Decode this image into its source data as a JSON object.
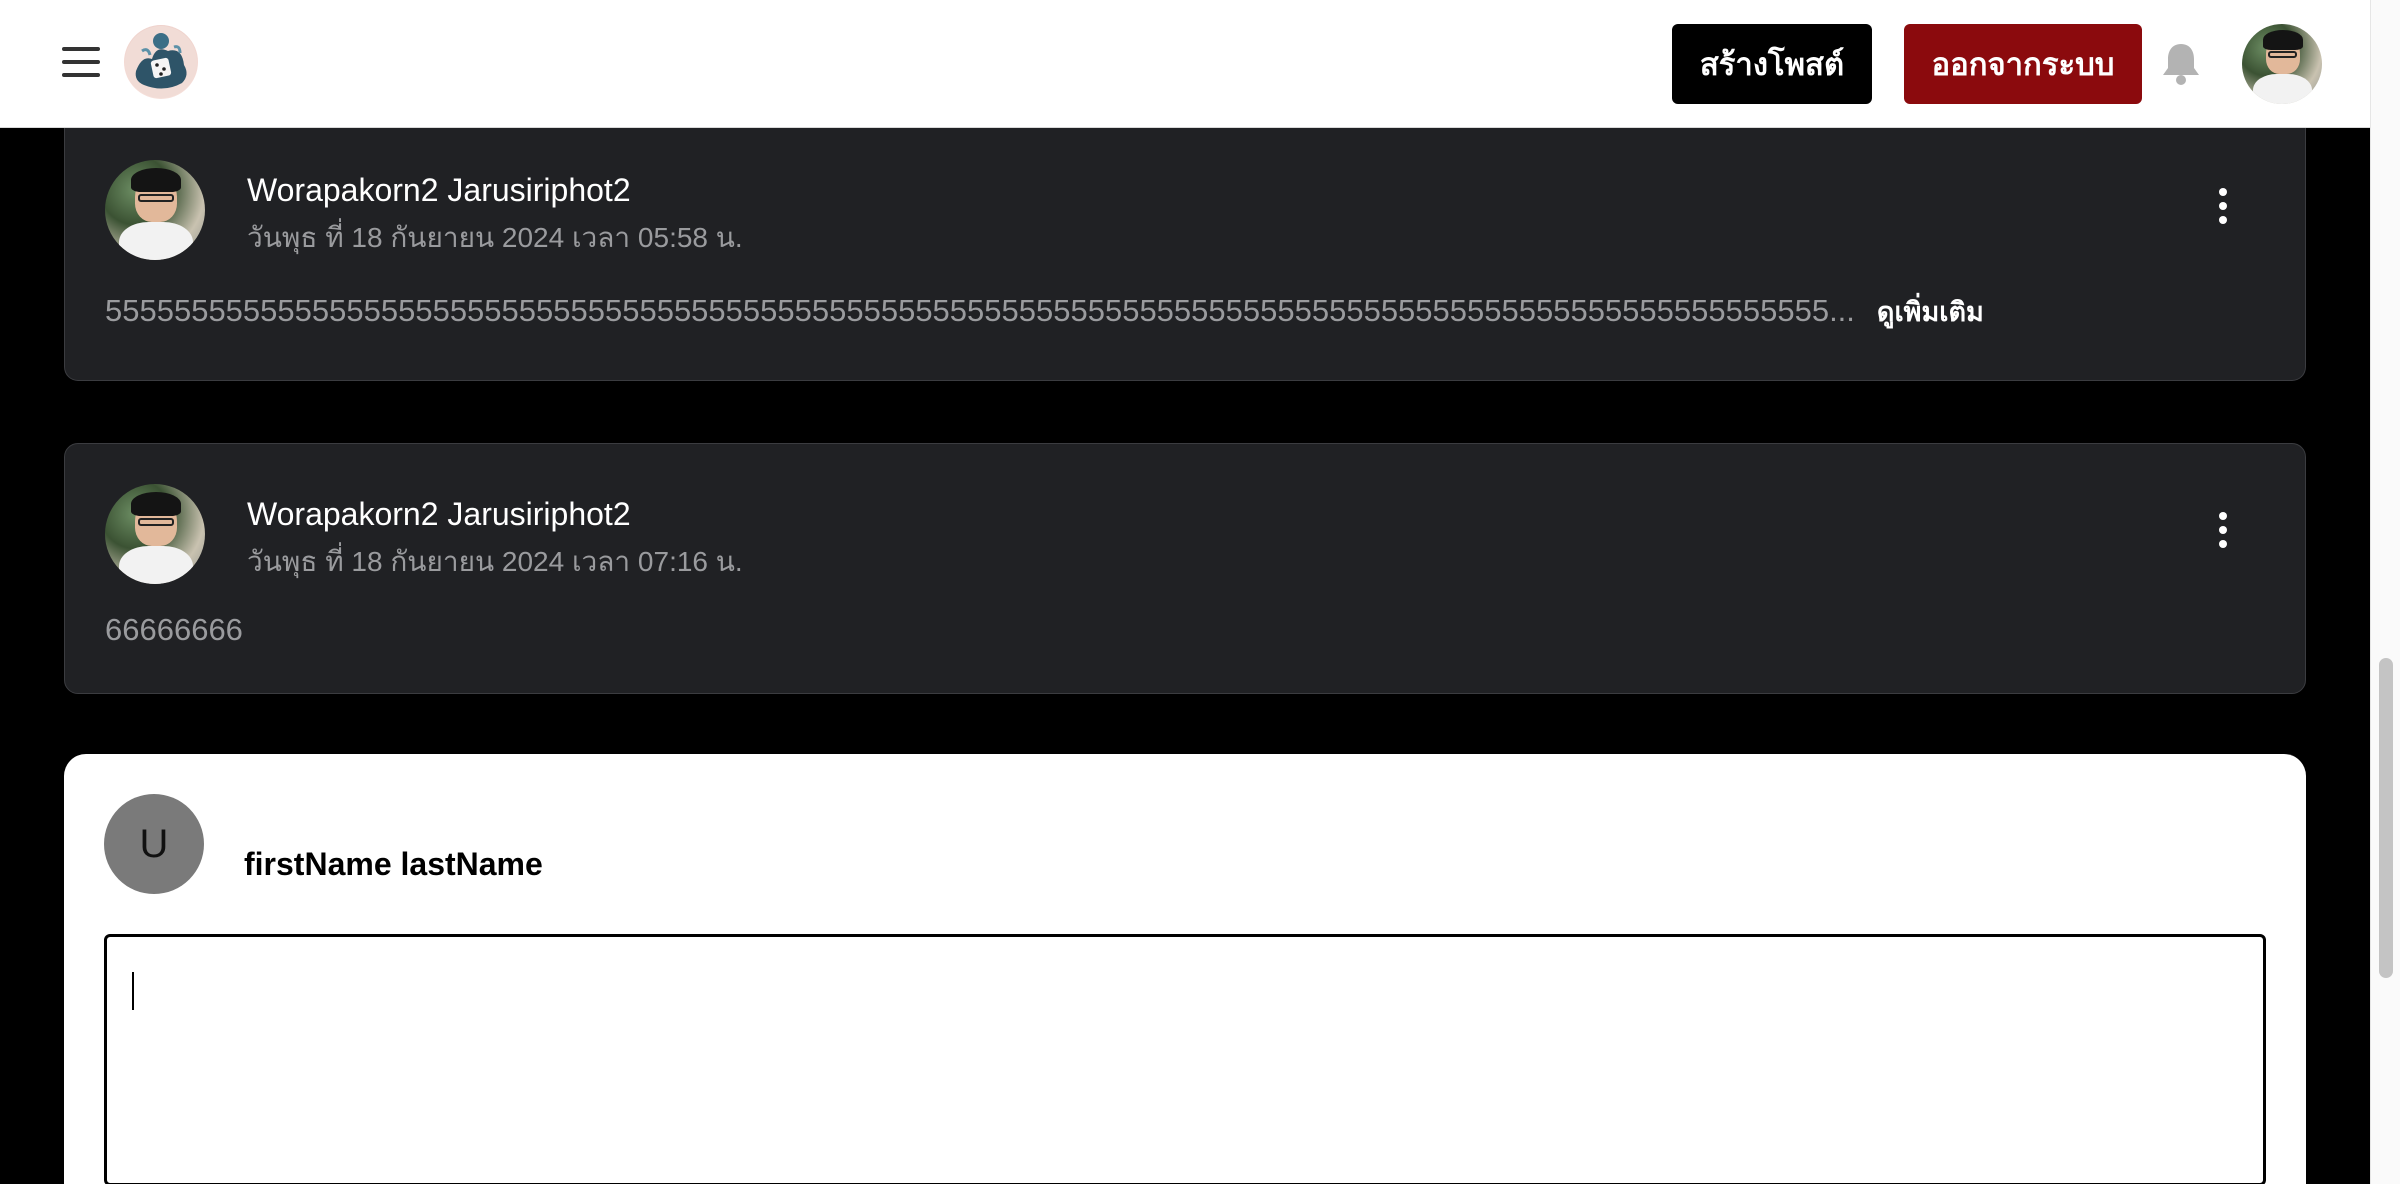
{
  "header": {
    "create_post_label": "สร้างโพสต์",
    "logout_label": "ออกจากระบบ",
    "menu_icon": "menu-icon",
    "logo_icon": "dice-logo-icon",
    "bell_icon": "bell-icon",
    "colors": {
      "create_bg": "#000000",
      "logout_bg": "#8b0a0d"
    }
  },
  "posts": [
    {
      "author": "Worapakorn2 Jarusiriphot2",
      "date": "วันพุธ ที่ 18 กันยายน 2024 เวลา 05:58 น.",
      "body": "5555555555555555555555555555555555555555555555555555555555555555555555555555555555555555555555555555...",
      "see_more": "ดูเพิ่มเติม"
    },
    {
      "author": "Worapakorn2 Jarusiriphot2",
      "date": "วันพุธ ที่ 18 กันยายน 2024 เวลา 07:16 น.",
      "body": "66666666"
    }
  ],
  "composer": {
    "avatar_initial": "U",
    "name": "firstName lastName",
    "value": ""
  },
  "theme": {
    "page_bg": "#000000",
    "card_bg": "#202124",
    "muted_text": "#9a9b9e"
  }
}
